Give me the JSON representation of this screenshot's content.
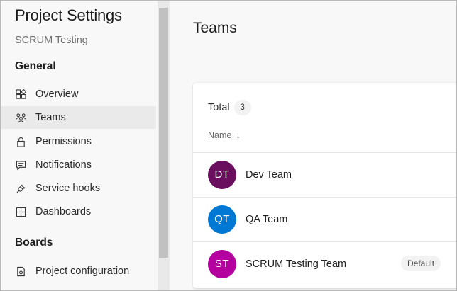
{
  "sidebar": {
    "title": "Project Settings",
    "project": "SCRUM Testing",
    "sections": {
      "general": "General",
      "boards": "Boards"
    },
    "items": [
      {
        "label": "Overview",
        "icon": "overview-icon"
      },
      {
        "label": "Teams",
        "icon": "teams-icon",
        "selected": true
      },
      {
        "label": "Permissions",
        "icon": "lock-icon"
      },
      {
        "label": "Notifications",
        "icon": "chat-icon"
      },
      {
        "label": "Service hooks",
        "icon": "plug-icon"
      },
      {
        "label": "Dashboards",
        "icon": "dashboard-icon"
      }
    ],
    "boards_items": [
      {
        "label": "Project configuration",
        "icon": "config-icon"
      }
    ]
  },
  "main": {
    "title": "Teams",
    "total_label": "Total",
    "total_count": "3",
    "column_name": "Name",
    "sort_indicator": "↓",
    "teams": [
      {
        "initials": "DT",
        "name": "Dev Team",
        "color": "#6a0f5e"
      },
      {
        "initials": "QT",
        "name": "QA Team",
        "color": "#0078d4"
      },
      {
        "initials": "ST",
        "name": "SCRUM Testing Team",
        "color": "#b4009e",
        "badge": "Default"
      }
    ]
  }
}
